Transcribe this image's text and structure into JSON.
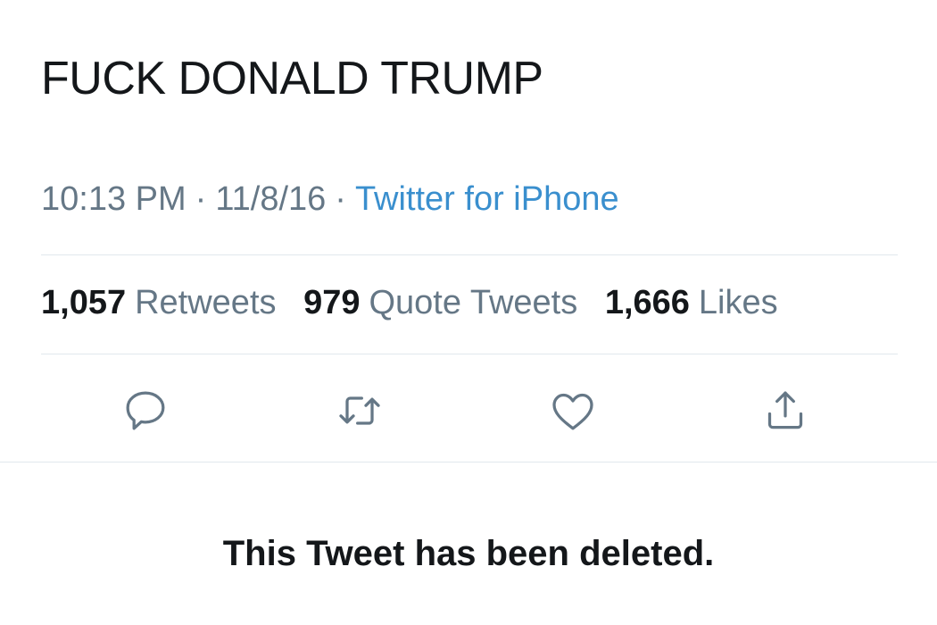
{
  "tweet": {
    "text": "FUCK DONALD TRUMP",
    "time": "10:13 PM",
    "date": "11/8/16",
    "separator": "·",
    "source": "Twitter for iPhone"
  },
  "stats": {
    "retweets_count": "1,057",
    "retweets_label": "Retweets",
    "quotes_count": "979",
    "quotes_label": "Quote Tweets",
    "likes_count": "1,666",
    "likes_label": "Likes"
  },
  "actions": {
    "reply_icon": "reply-icon",
    "retweet_icon": "retweet-icon",
    "like_icon": "heart-icon",
    "share_icon": "share-icon"
  },
  "notice": {
    "deleted_text": "This Tweet has been deleted."
  },
  "colors": {
    "text_primary": "#14171a",
    "text_secondary": "#657786",
    "link": "#3a8fce",
    "divider": "#e1e8ed",
    "icon": "#657786"
  }
}
